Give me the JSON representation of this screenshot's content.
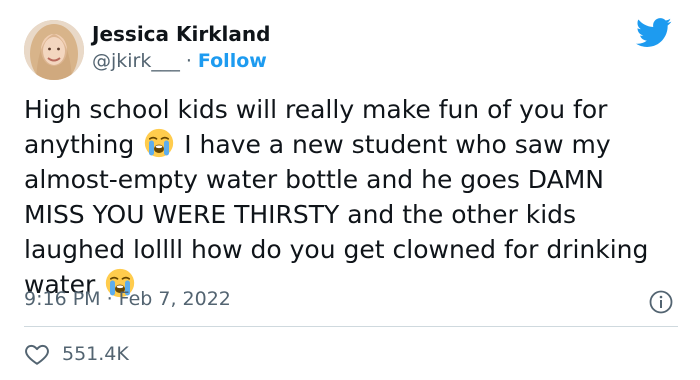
{
  "author": {
    "display_name": "Jessica Kirkland",
    "handle": "@jkirk___",
    "separator": "·",
    "follow_label": "Follow"
  },
  "tweet": {
    "line1": "High school kids will really make fun of you for",
    "line2_before_emoji": "anything",
    "line2_after_emoji": "I have a new student who saw my",
    "line3": "almost-empty water bottle and he goes DAMN",
    "line4": "MISS YOU WERE THIRSTY and the other kids",
    "line5": "laughed lollll how do you get clowned for drinking",
    "line6": "water",
    "emoji": "loudly-crying-face"
  },
  "timestamp": "9:16 PM · Feb 7, 2022",
  "likes": "551.4K",
  "colors": {
    "brand_blue": "#1d9bf0",
    "text": "#0f1419",
    "secondary_text": "#536471",
    "divider": "#cfd9de"
  },
  "icons": {
    "brand": "twitter-bird-icon",
    "info": "info-icon",
    "like": "heart-icon"
  }
}
